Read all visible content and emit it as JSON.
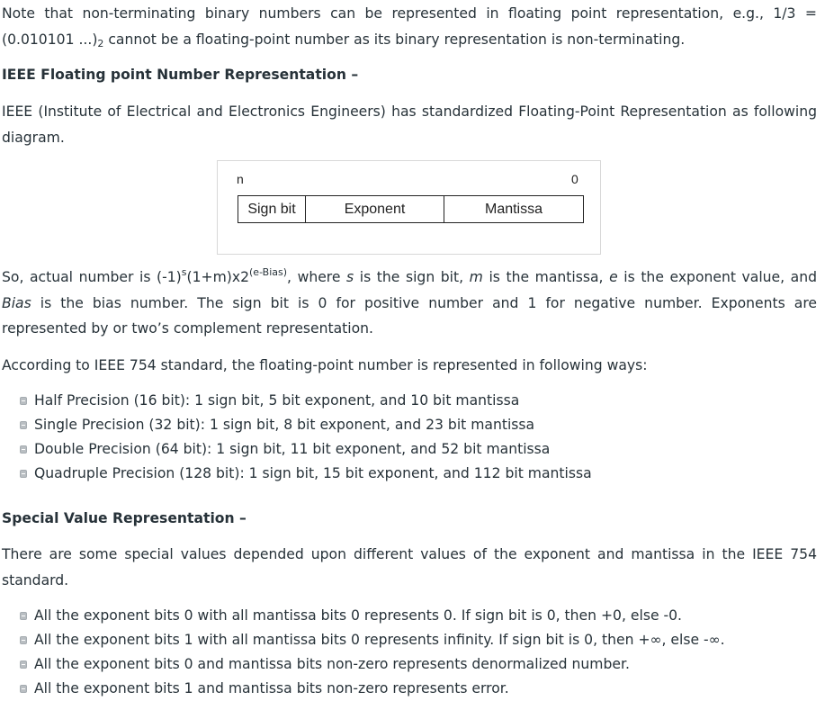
{
  "note": {
    "prefix": "Note that non-terminating binary numbers can be represented in floating point representation, e.g., 1/3 = (0.010101 ...)",
    "sub": "2",
    "suffix": " cannot be a floating-point number as its binary representation is non-terminating."
  },
  "heading1": "IEEE Floating point Number Representation –",
  "ieee_para": "IEEE (Institute of Electrical and Electronics Engineers) has standardized Floating-Point Representation as following diagram.",
  "figure": {
    "left_label": "n",
    "right_label": "0",
    "boxes": [
      "Sign bit",
      "Exponent",
      "Mantissa"
    ]
  },
  "so_para": {
    "t1": "So, actual number is (-1)",
    "sup1": "s",
    "t2": "(1+m)x2",
    "sup2": "(e-Bias)",
    "t3": ", where ",
    "s": "s",
    "t4": " is the sign bit, ",
    "m": "m",
    "t5": " is the mantissa, ",
    "e": "e",
    "t6": " is the exponent value, and ",
    "bias": "Bias",
    "t7": " is the bias number. The sign bit is 0 for positive number and 1 for negative number. Exponents are represented by or two’s complement representation."
  },
  "ieee754_para": "According to IEEE 754 standard, the floating-point number is represented in following ways:",
  "precisions": [
    "Half Precision (16 bit): 1 sign bit, 5 bit exponent, and 10 bit mantissa",
    "Single Precision (32 bit): 1 sign bit, 8 bit exponent, and 23 bit mantissa",
    "Double Precision (64 bit): 1 sign bit, 11 bit exponent, and 52 bit mantissa",
    "Quadruple Precision (128 bit): 1 sign bit, 15 bit exponent, and 112 bit mantissa"
  ],
  "heading2": "Special Value Representation –",
  "special_para": "There are some special values depended upon different values of the exponent and mantissa in the IEEE 754 standard.",
  "special_values": [
    "All the exponent bits 0 with all mantissa bits 0 represents 0. If sign bit is 0, then +0, else -0.",
    "All the exponent bits 1 with all mantissa bits 0 represents infinity. If sign bit is 0, then +∞, else -∞.",
    "All the exponent bits 0 and mantissa bits non-zero represents denormalized number.",
    "All the exponent bits 1 and mantissa bits non-zero represents error."
  ]
}
